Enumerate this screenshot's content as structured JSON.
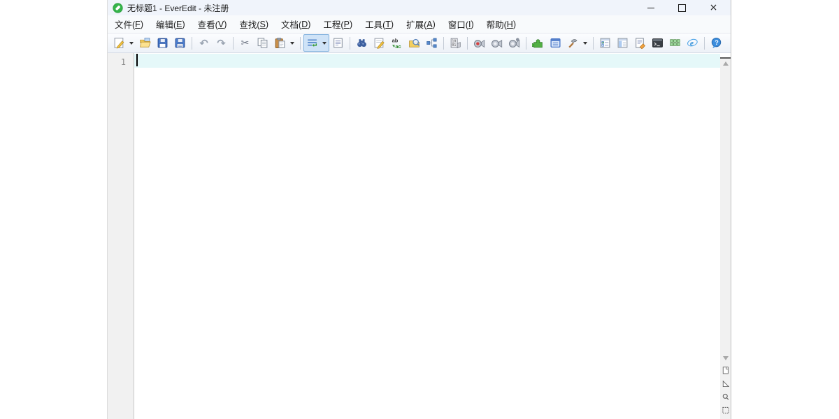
{
  "window": {
    "title": "无标题1 - EverEdit - 未注册",
    "controls": [
      "minimize",
      "maximize",
      "close"
    ]
  },
  "menubar": {
    "items": [
      {
        "id": "file",
        "label": "文件",
        "key": "F"
      },
      {
        "id": "edit",
        "label": "编辑",
        "key": "E"
      },
      {
        "id": "view",
        "label": "查看",
        "key": "V"
      },
      {
        "id": "search",
        "label": "查找",
        "key": "S"
      },
      {
        "id": "document",
        "label": "文档",
        "key": "D"
      },
      {
        "id": "project",
        "label": "工程",
        "key": "P"
      },
      {
        "id": "tools",
        "label": "工具",
        "key": "T"
      },
      {
        "id": "extensions",
        "label": "扩展",
        "key": "A"
      },
      {
        "id": "window",
        "label": "窗口",
        "key": "I"
      },
      {
        "id": "help",
        "label": "帮助",
        "key": "H"
      }
    ]
  },
  "toolbar": {
    "groups": [
      [
        {
          "name": "new-file",
          "dropdown": true
        },
        {
          "name": "open-folder"
        },
        {
          "name": "save"
        },
        {
          "name": "save-all"
        }
      ],
      [
        {
          "name": "undo"
        },
        {
          "name": "redo"
        }
      ],
      [
        {
          "name": "cut"
        },
        {
          "name": "copy"
        },
        {
          "name": "paste",
          "dropdown": true
        }
      ],
      [
        {
          "name": "word-wrap",
          "dropdown": true,
          "selected": true
        },
        {
          "name": "show-format"
        }
      ],
      [
        {
          "name": "find"
        },
        {
          "name": "quick-replace"
        },
        {
          "name": "replace"
        },
        {
          "name": "find-in-files"
        },
        {
          "name": "compare"
        }
      ],
      [
        {
          "name": "hex-view"
        }
      ],
      [
        {
          "name": "record-macro"
        },
        {
          "name": "play-macro"
        },
        {
          "name": "run-macro-multi"
        }
      ],
      [
        {
          "name": "plugin"
        },
        {
          "name": "script-window"
        },
        {
          "name": "tools",
          "dropdown": true
        }
      ],
      [
        {
          "name": "settings-list"
        },
        {
          "name": "sidebar-toggle"
        },
        {
          "name": "doc-edit"
        },
        {
          "name": "terminal"
        },
        {
          "name": "char-table"
        },
        {
          "name": "browser-preview"
        }
      ],
      [
        {
          "name": "help"
        }
      ]
    ]
  },
  "editor": {
    "line_numbers": [
      "1"
    ],
    "content": "",
    "active_line": 1
  },
  "scrollbar": {
    "bottom_tools": [
      "document-map",
      "ruler",
      "magnifier",
      "column-select"
    ]
  },
  "colors": {
    "titlebar-bg": "#f0f4fb",
    "active-line": "#e5f8f9",
    "selected-bg": "#cfe3f7",
    "selected-border": "#7fb0dd"
  }
}
